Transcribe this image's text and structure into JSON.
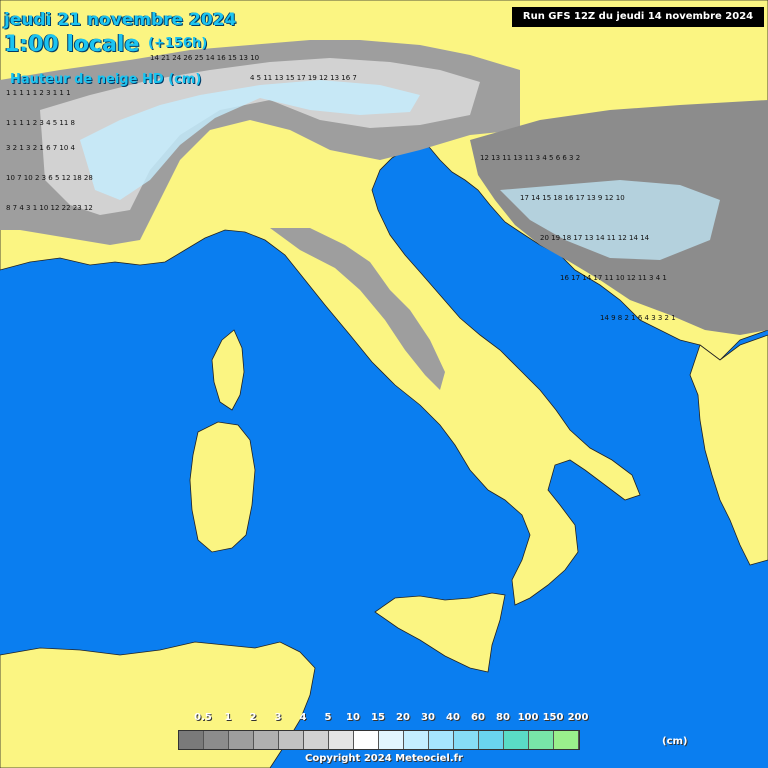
{
  "header": {
    "date": "jeudi 21 novembre 2024",
    "time": "1:00 locale",
    "lead": "(+156h)",
    "parameter": "Hauteur de neige HD (cm)"
  },
  "run": {
    "label": "Run GFS 12Z du jeudi 14 novembre 2024"
  },
  "legend": {
    "unit": "(cm)",
    "items": [
      {
        "label": "0.5",
        "color": "#7a7a7a"
      },
      {
        "label": "1",
        "color": "#8c8c8c"
      },
      {
        "label": "2",
        "color": "#9e9e9e"
      },
      {
        "label": "3",
        "color": "#b0b0b0"
      },
      {
        "label": "4",
        "color": "#c2c2c2"
      },
      {
        "label": "5",
        "color": "#d2d2d2"
      },
      {
        "label": "10",
        "color": "#e4e4e4"
      },
      {
        "label": "15",
        "color": "#ffffff"
      },
      {
        "label": "20",
        "color": "#e2f6ff"
      },
      {
        "label": "30",
        "color": "#c4eeff"
      },
      {
        "label": "40",
        "color": "#a6e6ff"
      },
      {
        "label": "60",
        "color": "#86dcf6"
      },
      {
        "label": "80",
        "color": "#6ad4ee"
      },
      {
        "label": "100",
        "color": "#5adcc6"
      },
      {
        "label": "150",
        "color": "#78e6a8"
      },
      {
        "label": "200",
        "color": "#9af08c"
      }
    ]
  },
  "map": {
    "sea_color": "#0a7ef0",
    "land_color": "#fbf582",
    "snow_colors": [
      "#8c8c8c",
      "#b0b0b0",
      "#d2d2d2",
      "#c4eeff"
    ]
  },
  "copyright": "Copyright 2024 Meteociel.fr"
}
